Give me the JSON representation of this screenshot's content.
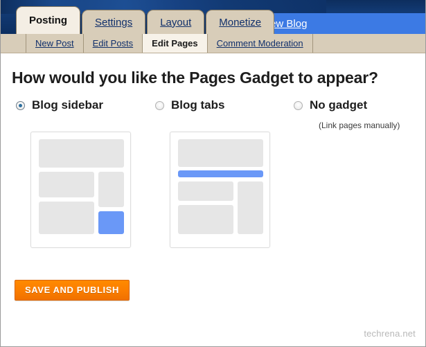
{
  "window": {
    "watermark": "techrena.net"
  },
  "topnav": {
    "tabs": [
      {
        "label": "Posting",
        "active": true
      },
      {
        "label": "Settings",
        "active": false
      },
      {
        "label": "Layout",
        "active": false
      },
      {
        "label": "Monetize",
        "active": false
      }
    ],
    "view_blog_label": "View Blog",
    "bar_color": "#3c7ae4",
    "background_color": "#0c2e60"
  },
  "subnav": {
    "items": [
      {
        "label": "New Post",
        "active": false
      },
      {
        "label": "Edit Posts",
        "active": false
      },
      {
        "label": "Edit Pages",
        "active": true
      },
      {
        "label": "Comment Moderation",
        "active": false
      }
    ],
    "background_color": "#d8cdb9"
  },
  "main": {
    "heading": "How would you like the Pages Gadget to appear?",
    "options": [
      {
        "label": "Blog sidebar",
        "selected": true
      },
      {
        "label": "Blog tabs",
        "selected": false
      },
      {
        "label": "No gadget",
        "selected": false
      }
    ],
    "no_gadget_hint": "(Link pages manually)",
    "previews": [
      {
        "name": "blog-sidebar-preview",
        "accent_color": "#6a98f7"
      },
      {
        "name": "blog-tabs-preview",
        "accent_color": "#6a98f7"
      }
    ],
    "save_button_label": "SAVE AND PUBLISH",
    "save_button_color": "#fb7e00",
    "placeholder_block_color": "#e6e6e6"
  }
}
